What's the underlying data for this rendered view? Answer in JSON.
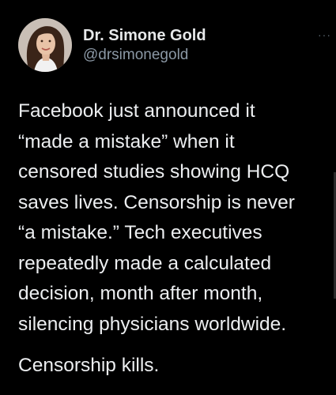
{
  "tweet": {
    "author": {
      "display_name": "Dr. Simone Gold",
      "handle": "@drsimonegold",
      "avatar_icon": "profile-photo"
    },
    "more_menu": "···",
    "body_lines": [
      "Facebook just announced it",
      "“made a mistake” when it",
      "censored studies showing HCQ",
      "saves lives. Censorship is never",
      "“a mistake.”  Tech executives",
      "repeatedly made a calculated",
      "decision, month after month,",
      "silencing physicians worldwide."
    ],
    "closing_line": "Censorship kills."
  },
  "colors": {
    "background": "#000000",
    "text": "#eceef0",
    "secondary_text": "#8b98a5"
  }
}
